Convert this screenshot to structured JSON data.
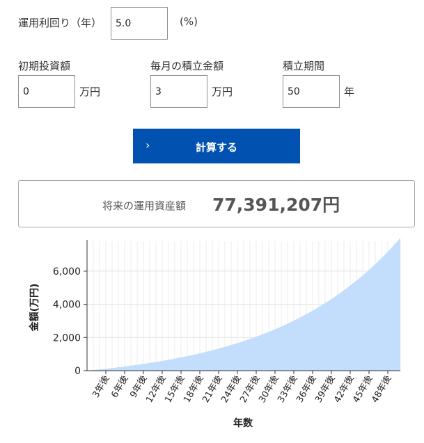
{
  "form": {
    "rate": {
      "label": "運用利回り（年）",
      "value": "5.0",
      "unit": "(%)"
    },
    "initial": {
      "label": "初期投資額",
      "value": "0",
      "unit": "万円"
    },
    "monthly": {
      "label": "毎月の積立金額",
      "value": "3",
      "unit": "万円"
    },
    "period": {
      "label": "積立期間",
      "value": "50",
      "unit": "年"
    },
    "submit_label": "計算する",
    "submit_icon": "chevron-right-icon"
  },
  "result": {
    "label": "将来の運用資産額",
    "value": "77,391,207円"
  },
  "chart_data": {
    "type": "area",
    "xlabel": "年数",
    "ylabel": "金額(万円)",
    "ylim": [
      0,
      7800
    ],
    "yticks": [
      0,
      2000,
      4000,
      6000
    ],
    "ytick_labels": [
      "0",
      "2,000",
      "4,000",
      "6,000"
    ],
    "xtick_labels": [
      "3年後",
      "6年後",
      "9年後",
      "12年後",
      "15年後",
      "18年後",
      "21年後",
      "24年後",
      "27年後",
      "30年後",
      "33年後",
      "36年後",
      "39年後",
      "42年後",
      "45年後",
      "48年後"
    ],
    "x": [
      0,
      50
    ],
    "grid": true,
    "series_color": "#c2defc",
    "growth": {
      "annual_rate_percent": 5.0,
      "monthly_contribution_man_yen": 3,
      "initial_man_yen": 0,
      "end_value_man_yen": 7739
    }
  }
}
